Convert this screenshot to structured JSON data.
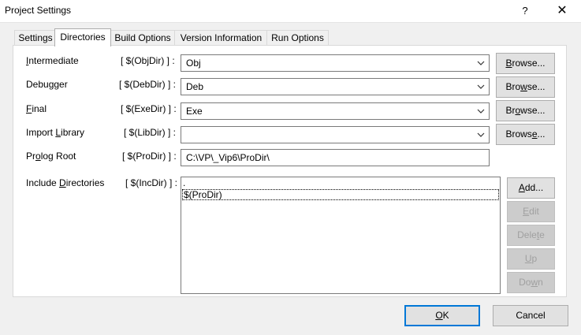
{
  "window": {
    "title": "Project Settings",
    "help": "?",
    "close": "✕"
  },
  "tabs": [
    {
      "label": "Settings"
    },
    {
      "label": "Directories"
    },
    {
      "label": "Build Options"
    },
    {
      "label": "Version Information"
    },
    {
      "label": "Run Options"
    }
  ],
  "active_tab": "Directories",
  "rows": {
    "intermediate": {
      "label_mn": "I",
      "label_rest": "ntermediate",
      "macro": "[ $(ObjDir) ] :",
      "value": "Obj",
      "browse_mn": "B",
      "browse_rest": "rowse..."
    },
    "debugger": {
      "label": "Debugger",
      "macro": "[ $(DebDir) ] :",
      "value": "Deb",
      "browse_pre": "Bro",
      "browse_mn": "w",
      "browse_rest": "se..."
    },
    "final": {
      "label_mn": "F",
      "label_rest": "inal",
      "macro": "[ $(ExeDir) ] :",
      "value": "Exe",
      "browse_pre": "Br",
      "browse_mn": "o",
      "browse_rest": "wse..."
    },
    "import_library": {
      "label_pre": "Import ",
      "label_mn": "L",
      "label_rest": "ibrary",
      "macro": "[ $(LibDir) ] :",
      "value": "",
      "browse_pre": "Brows",
      "browse_mn": "e",
      "browse_rest": "..."
    },
    "prolog_root": {
      "label_pre": "Pr",
      "label_mn": "o",
      "label_rest": "log Root",
      "macro": "[ $(ProDir) ] :",
      "value": "C:\\VP\\_Vip6\\ProDir\\"
    },
    "include_dirs": {
      "label_pre": "Include ",
      "label_mn": "D",
      "label_rest": "irectories",
      "macro": "[ $(IncDir) ] :",
      "items": [
        ".",
        "$(ProDir)"
      ]
    }
  },
  "side_buttons": {
    "add": {
      "mn": "A",
      "rest": "dd..."
    },
    "edit": {
      "mn": "E",
      "rest": "dit"
    },
    "delete": {
      "pre": "Dele",
      "mn": "t",
      "rest": "e"
    },
    "up": {
      "mn": "U",
      "rest": "p"
    },
    "down": {
      "pre": "Do",
      "mn": "w",
      "rest": "n"
    }
  },
  "footer": {
    "ok_mn": "O",
    "ok_rest": "K",
    "cancel": "Cancel"
  }
}
